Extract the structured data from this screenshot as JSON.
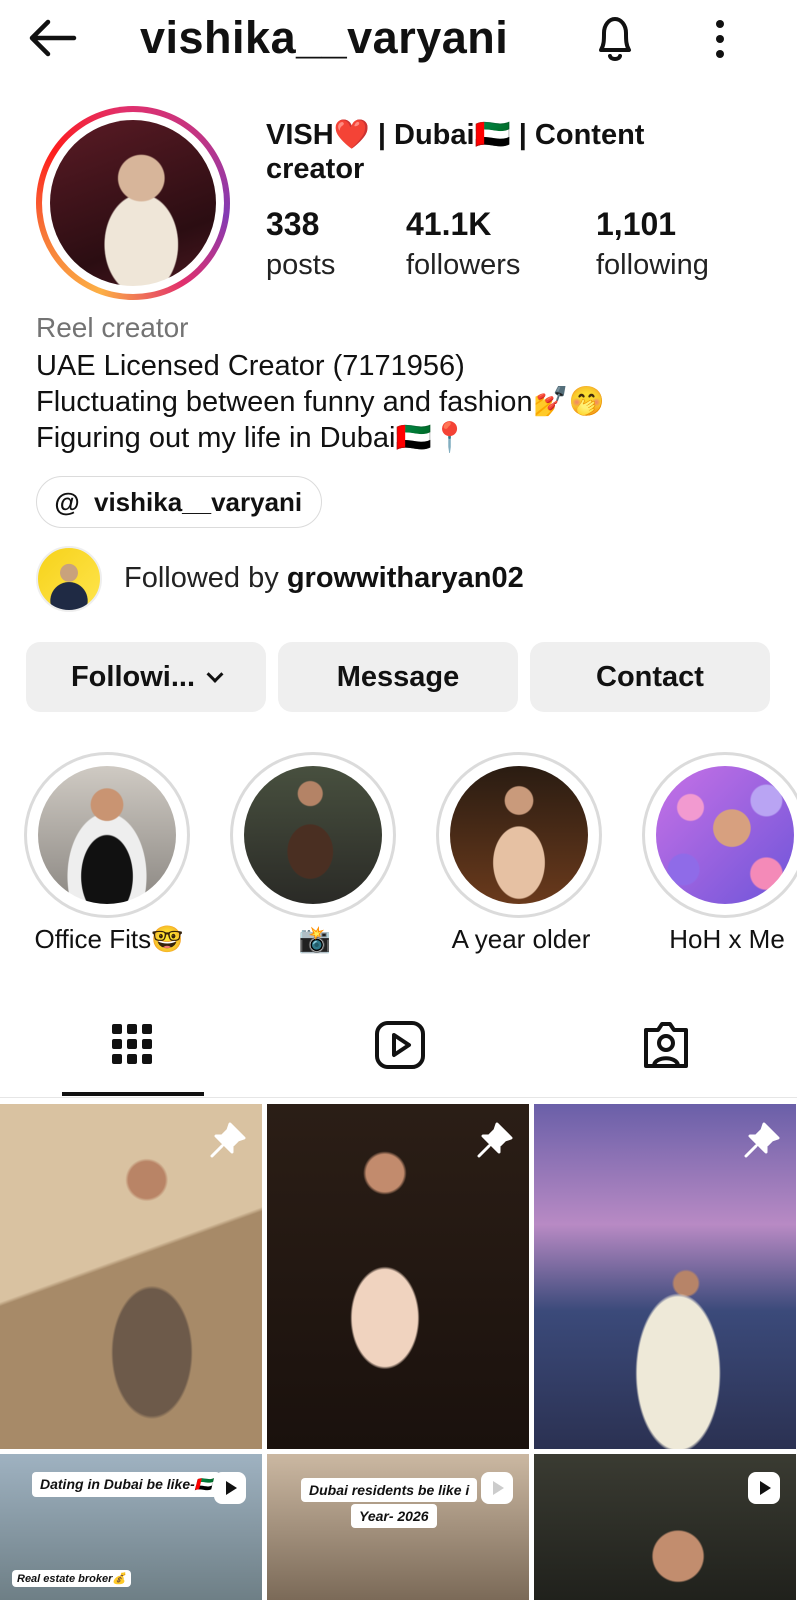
{
  "profile": {
    "username": "vishika__varyani",
    "display_name": "VISH❤️ | Dubai🇦🇪 | Content creator",
    "stats": {
      "posts": {
        "value": "338",
        "label": "posts"
      },
      "followers": {
        "value": "41.1K",
        "label": "followers"
      },
      "following": {
        "value": "1,101",
        "label": "following"
      }
    },
    "category": "Reel creator",
    "bio": "UAE Licensed Creator (7171956)\nFluctuating between funny and fashion💅🤭\nFiguring out my life in Dubai🇦🇪📍",
    "threads_handle": "vishika__varyani",
    "followed_by_prefix": "Followed by ",
    "followed_by_user": "growwitharyan02"
  },
  "actions": {
    "following_label": "Followi...",
    "message_label": "Message",
    "contact_label": "Contact"
  },
  "highlights": [
    {
      "label": "Office Fits🤓"
    },
    {
      "label": "📸"
    },
    {
      "label": "A year older"
    },
    {
      "label": "HoH x Me"
    }
  ],
  "tabs": [
    {
      "name": "posts-grid",
      "icon": "grid-icon",
      "active": true
    },
    {
      "name": "reels",
      "icon": "reels-icon",
      "active": false
    },
    {
      "name": "tagged",
      "icon": "tagged-icon",
      "active": false
    }
  ],
  "grid": {
    "captions": {
      "c4": "Dating in Dubai be like-🇦🇪",
      "c4_sub": "Real estate broker💰",
      "c5": "Dubai residents be like i",
      "c5_sub": "Year- 2026"
    },
    "pinned": [
      true,
      true,
      true
    ]
  },
  "colors": {
    "button_bg": "#efefef",
    "muted_text": "#737373",
    "story_ring": "#e1306c"
  }
}
